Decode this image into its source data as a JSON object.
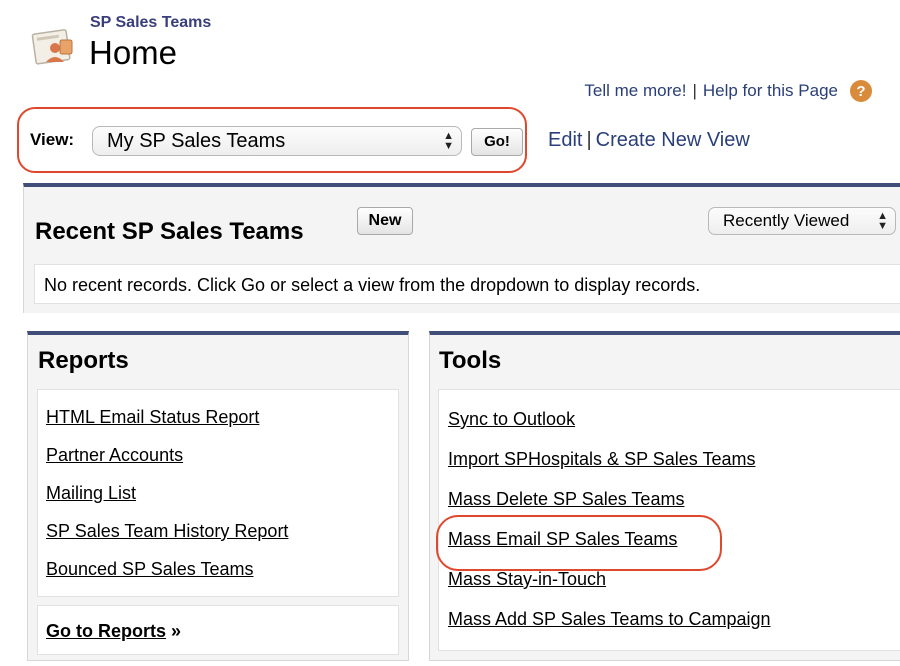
{
  "header": {
    "app_name": "SP Sales Teams",
    "page_title": "Home",
    "help_links": {
      "tell_me_more": "Tell me more!",
      "separator": "|",
      "help_for_page": "Help for this Page",
      "help_icon": "question-icon"
    }
  },
  "view_selector": {
    "label": "View:",
    "selected": "My SP Sales Teams",
    "go_label": "Go!",
    "edit_label": "Edit",
    "separator": "|",
    "create_label": "Create New View"
  },
  "recent": {
    "title": "Recent SP Sales Teams",
    "new_label": "New",
    "filter_selected": "Recently Viewed",
    "empty_message": "No recent records. Click Go or select a view from the dropdown to display records."
  },
  "reports": {
    "title": "Reports",
    "items": [
      "HTML Email Status Report",
      "Partner Accounts",
      "Mailing List",
      "SP Sales Team History Report",
      "Bounced SP Sales Teams"
    ],
    "go_to_reports": "Go to Reports",
    "go_to_reports_arrow": "»"
  },
  "tools": {
    "title": "Tools",
    "items": [
      "Sync to Outlook",
      "Import SPHospitals & SP Sales Teams",
      "Mass Delete SP Sales Teams",
      "Mass Email SP Sales Teams",
      "Mass Stay-in-Touch",
      "Mass Add SP Sales Teams to Campaign"
    ]
  },
  "colors": {
    "highlight_outline": "#e0472d",
    "panel_top_border": "#3f4d78",
    "link_blue": "#2a3f7a",
    "app_name": "#3a3f7c"
  }
}
